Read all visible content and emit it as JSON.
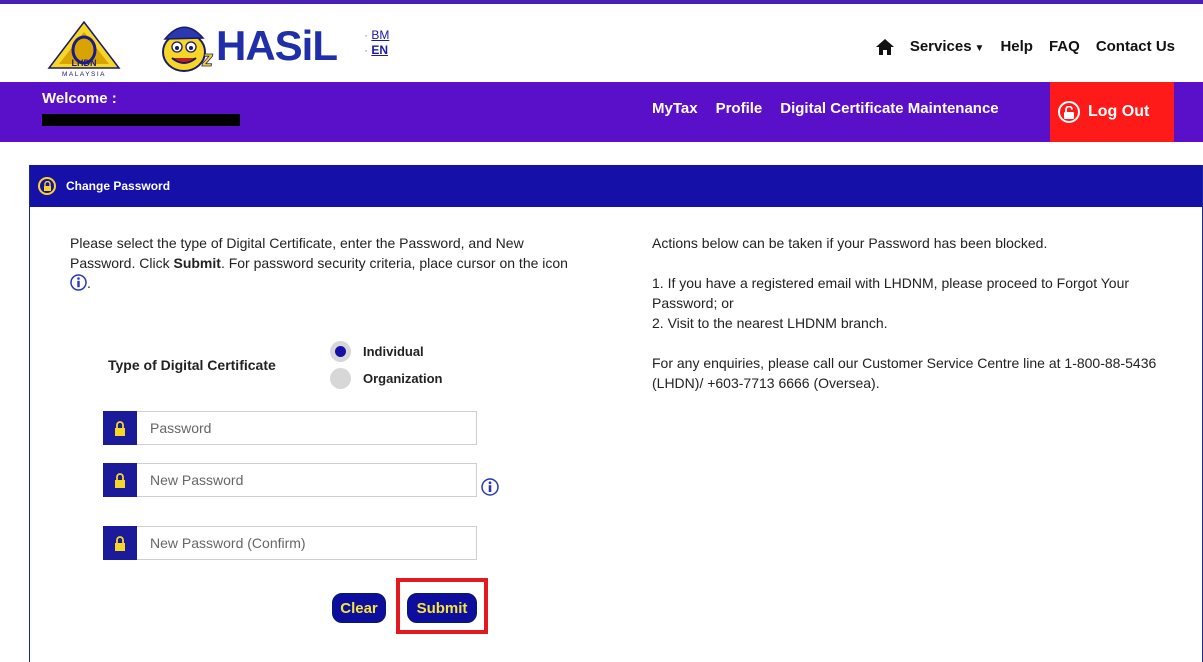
{
  "header": {
    "lang_bm": "BM",
    "lang_en": "EN",
    "nav": {
      "services": "Services",
      "help": "Help",
      "faq": "FAQ",
      "contact": "Contact Us"
    },
    "logo_lhdn_text": "LHDN",
    "logo_malaysia_text": "MALAYSIA",
    "logo_hasil_text": "HASiL"
  },
  "bar": {
    "welcome": "Welcome :",
    "nav": {
      "mytax": "MyTax",
      "profile": "Profile",
      "digital_cert": "Digital Certificate Maintenance"
    },
    "logout": "Log Out"
  },
  "panel": {
    "title": "Change Password",
    "instructions_1": "Please select the type of Digital Certificate, enter the Password, and New Password. Click",
    "instructions_submit": "Submit",
    "instructions_2": ". For password security criteria, place cursor on the icon",
    "instructions_end": ".",
    "cert_label": "Type of Digital Certificate",
    "radio_individual": "Individual",
    "radio_organization": "Organization",
    "selected_type": "Individual",
    "password_placeholder": "Password",
    "new_password_placeholder": "New Password",
    "confirm_placeholder": "New Password (Confirm)",
    "clear_label": "Clear",
    "submit_label": "Submit"
  },
  "right": {
    "p1": "Actions below can be taken if your Password has been blocked.",
    "p2_line1": "1. If you have a registered email with LHDNM, please proceed to Forgot Your Password; or",
    "p2_line2": "2. Visit to the nearest LHDNM branch.",
    "p3": "For any enquiries, please call our Customer Service Centre line at 1-800-88-5436 (LHDN)/ +603-7713 6666 (Oversea)."
  },
  "colors": {
    "purple": "#5a10c8",
    "navy": "#1510a8",
    "logout_red": "#ff1a1a",
    "button_text": "#f5e63a",
    "highlight": "#e3191f"
  },
  "icons": [
    "lhdn-logo",
    "hasil-logo",
    "home-icon",
    "caret-down-icon",
    "unlock-icon",
    "lock-icon",
    "info-icon",
    "radio-icon"
  ]
}
